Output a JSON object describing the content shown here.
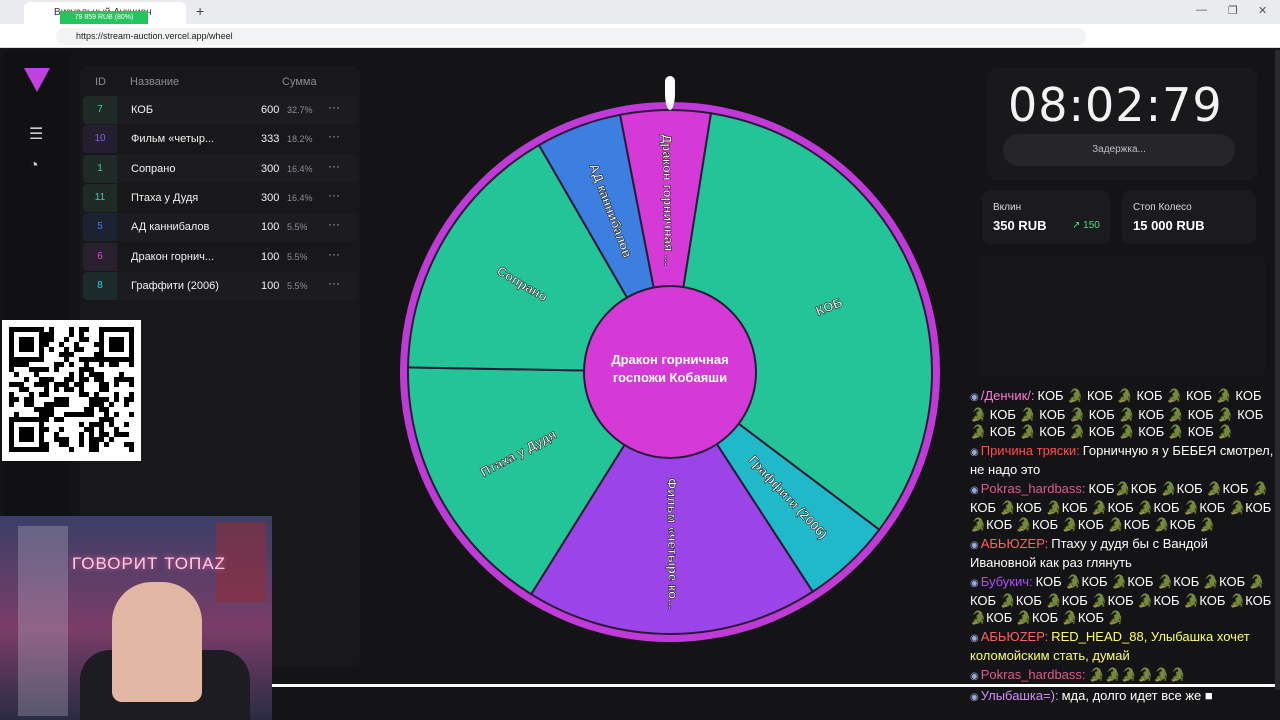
{
  "browser": {
    "tab_title": "Визуальный Аукцион",
    "tab_progress": "79 859 RUB (80%)",
    "url": "https://stream-auction.vercel.app/wheel",
    "new_tab": "+",
    "win_min": "—",
    "win_max": "❐",
    "win_close": "✕",
    "back": "←",
    "reload": "↻"
  },
  "list": {
    "headers": {
      "id": "ID",
      "name": "Название",
      "sum": "Сумма"
    },
    "rows": [
      {
        "id": "7",
        "name": "КОБ",
        "amount": "600",
        "percent": "32.7%",
        "color": "#3ec9a7",
        "bg": "#1f2a27"
      },
      {
        "id": "10",
        "name": "Фильм «четыр...",
        "amount": "333",
        "percent": "18.2%",
        "color": "#8b5cf6",
        "bg": "#241f2e"
      },
      {
        "id": "1",
        "name": "Сопрано",
        "amount": "300",
        "percent": "16.4%",
        "color": "#3ec9a7",
        "bg": "#1f2a27"
      },
      {
        "id": "11",
        "name": "Птаха у Дудя",
        "amount": "300",
        "percent": "16.4%",
        "color": "#3ec9a7",
        "bg": "#1f2a27"
      },
      {
        "id": "5",
        "name": "АД каннибалов",
        "amount": "100",
        "percent": "5.5%",
        "color": "#3b82f6",
        "bg": "#1d2230"
      },
      {
        "id": "6",
        "name": "Дракон горнич...",
        "amount": "100",
        "percent": "5.5%",
        "color": "#d946ef",
        "bg": "#2a1f2c"
      },
      {
        "id": "8",
        "name": "Граффити (2006)",
        "amount": "100",
        "percent": "5.5%",
        "color": "#22d3ee",
        "bg": "#1d2a2c"
      }
    ],
    "more": "···"
  },
  "wheel": {
    "center_line1": "Дракон горничная",
    "center_line2": "госпожи Кобаяши",
    "segments": [
      {
        "label": "Дракон горничная ...",
        "color": "#d63ad6",
        "sweep": 20
      },
      {
        "label": "КОБ",
        "color": "#23c497",
        "sweep": 118
      },
      {
        "label": "Граффити (2006)",
        "color": "#1fb9c9",
        "sweep": 20
      },
      {
        "label": "Фильм «четыре ко...",
        "color": "#9b45e8",
        "sweep": 65
      },
      {
        "label": "Птаха у Дудя",
        "color": "#23c497",
        "sweep": 59
      },
      {
        "label": "Сопрано",
        "color": "#23c497",
        "sweep": 59
      },
      {
        "label": "АД каннибалов",
        "color": "#3d7fe0",
        "sweep": 19
      }
    ],
    "rim_color": "#c03ad8"
  },
  "timer": {
    "value": "08:02:79",
    "delay_label": "Задержка..."
  },
  "stats": {
    "invested_label": "Вклин",
    "invested_value": "350 RUB",
    "invested_delta": "↗ 150",
    "stop_label": "Стоп Колесо",
    "stop_value": "15 000 RUB"
  },
  "chat": [
    {
      "user": "/Денчик/:",
      "user_color": "#ff7ad9",
      "text": "КОБ 🐊 КОБ 🐊 КОБ 🐊 КОБ 🐊 КОБ 🐊 КОБ 🐊 КОБ 🐊 КОБ 🐊 КОБ 🐊 КОБ 🐊 КОБ 🐊 КОБ 🐊 КОБ 🐊 КОБ 🐊 КОБ 🐊 КОБ 🐊"
    },
    {
      "user": "Причина тряски:",
      "user_color": "#ff4f4f",
      "text": "Горничную я у БЕБЕЯ смотрел, не надо это"
    },
    {
      "user": "Pokras_hardbass:",
      "user_color": "#e05a8a",
      "text": "КОБ🐊КОБ 🐊КОБ 🐊КОБ 🐊КОБ 🐊КОБ 🐊КОБ 🐊КОБ 🐊КОБ 🐊КОБ 🐊КОБ 🐊КОБ 🐊КОБ 🐊КОБ 🐊КОБ 🐊КОБ 🐊"
    },
    {
      "user": "АБЬЮZЕР:",
      "user_color": "#ff6060",
      "text": "Птаху у дудя бы с Вандой Ивановной как раз глянуть"
    },
    {
      "user": "Бубукич:",
      "user_color": "#b14bff",
      "text": "КОБ 🐊КОБ 🐊КОБ 🐊КОБ 🐊КОБ 🐊КОБ 🐊КОБ 🐊КОБ 🐊КОБ 🐊КОБ 🐊КОБ 🐊КОБ 🐊КОБ 🐊КОБ 🐊КОБ 🐊"
    },
    {
      "user": "АБЬЮZЕР:",
      "user_color": "#ff6060",
      "text": "RED_HEAD_88, Улыбашка хочет коломойским стать, думай",
      "text_color": "#ffff66"
    },
    {
      "user": "Pokras_hardbass:",
      "user_color": "#e05a8a",
      "text": "🐊🐊🐊🐊🐊🐊"
    },
    {
      "user": "Улыбашка=):",
      "user_color": "#d38cff",
      "text": "мда, долго идет все же ■"
    }
  ]
}
